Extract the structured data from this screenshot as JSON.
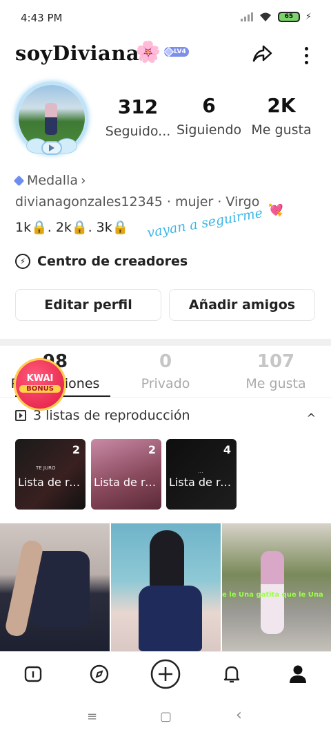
{
  "status_bar": {
    "time": "4:43 PM",
    "battery": "65"
  },
  "header": {
    "username": "soyDiviana",
    "flower": "🌸",
    "level": "LV4"
  },
  "stats": [
    {
      "num": "312",
      "label": "Seguido..."
    },
    {
      "num": "6",
      "label": "Siguiendo"
    },
    {
      "num": "2K",
      "label": "Me gusta"
    }
  ],
  "medal": "Medalla",
  "medal_chevron": "›",
  "info": "divianagonzales12345 · mujer · Virgo",
  "bio": "1k🔒. 2k🔒. 3k🔒",
  "handwritten": "vayan a seguirme",
  "heart": "💘",
  "creators": {
    "icon": "⚡",
    "label": "Centro de creadores"
  },
  "buttons": {
    "edit": "Editar perfil",
    "add_friends": "Añadir amigos"
  },
  "tabs": [
    {
      "num": "98",
      "label": "Publicaciones"
    },
    {
      "num": "0",
      "label": "Privado"
    },
    {
      "num": "107",
      "label": "Me gusta"
    }
  ],
  "kwai": {
    "line1": "KWAI",
    "line2": "BONUS"
  },
  "playlists": {
    "heading": "3 listas de reproducción",
    "caret": "^",
    "items": [
      {
        "count": "2",
        "title": "Lista de reproducc...",
        "overlay": "TE JURO"
      },
      {
        "count": "2",
        "title": "Lista de reproducc..."
      },
      {
        "count": "4",
        "title": "Lista de reproducc...",
        "overlay": "..."
      }
    ]
  },
  "videos": [
    {
      "caption": ""
    },
    {
      "caption": ""
    },
    {
      "caption": "e le   Una gatita que le   Una"
    }
  ],
  "system_nav": {
    "menu": "≡",
    "home": "▢",
    "back": "‹"
  },
  "colors": {
    "accent_blue": "#3fb6e6",
    "kwai_red": "#e0143e",
    "battery_green": "#7bd36b"
  }
}
